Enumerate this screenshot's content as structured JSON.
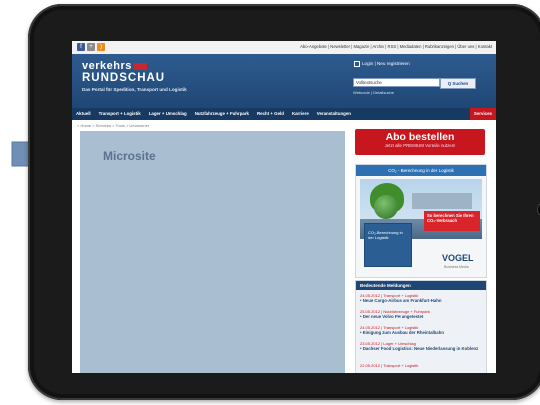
{
  "page": {
    "top_links": "Abo-Angebote | Newsletter | Magazin | Archiv | RSS | Mediadaten | Rubrikanzeigen | Über uns | Kontakt",
    "brand": {
      "line1": "verkehrs",
      "line2": "RUNDSCHAU",
      "tagline": "Das Portal für Spedition, Transport und Logistik"
    },
    "login_text": "Login | Neu registrieren",
    "search": {
      "value": "Volltextsuche",
      "button": "Q Suchen",
      "sub": "Webcode | Detailsuche"
    },
    "nav": [
      "Aktuell",
      "Transport + Logistik",
      "Lager + Umschlag",
      "Nutzfahrzeuge + Fuhrpark",
      "Recht + Geld",
      "Karriere",
      "Veranstaltungen",
      "Services"
    ],
    "breadcrumb": "> Home > Services > Tools > Umrechner",
    "microsite_label": "Microsite",
    "abo": {
      "title": "Abo bestellen",
      "subtitle": "Jetzt alle PREMIUM Vorteile nutzen!"
    },
    "promo": {
      "header": "CO₂ - Berechnung in der Logistik",
      "badge": "So berechnen Sie Ihren CO₂-Verbrauch",
      "book_label": "CO₂-Berechnung in der Logistik",
      "vogel": "VOGEL",
      "vogel_sub": "Business Media"
    },
    "news": {
      "header": "Bedeutende Meldungen",
      "items": [
        {
          "date": "24.05.2012 | Transport + Logistik",
          "title": "• Neue Cargo-Airbus am Frankfurt-Hahn"
        },
        {
          "date": "25.05.2012 | Nutzfahrzeuge + Fuhrpark",
          "title": "• Der neue Volvo FH angetestet"
        },
        {
          "date": "24.05.2012 | Transport + Logistik",
          "title": "• Einigung zum Ausbau der Rheintalbahn"
        },
        {
          "date": "23.05.2012 | Lager + Umschlag",
          "title": "• Dachser Food Logistics: Neue Niederlassung in Koblenz"
        },
        {
          "date": "22.05.2012 | Transport + Logistik",
          "title": ""
        }
      ]
    },
    "colors": {
      "brand_blue": "#1f4775",
      "accent_red": "#c7161e",
      "microsite_bg": "#a9bed1"
    }
  }
}
